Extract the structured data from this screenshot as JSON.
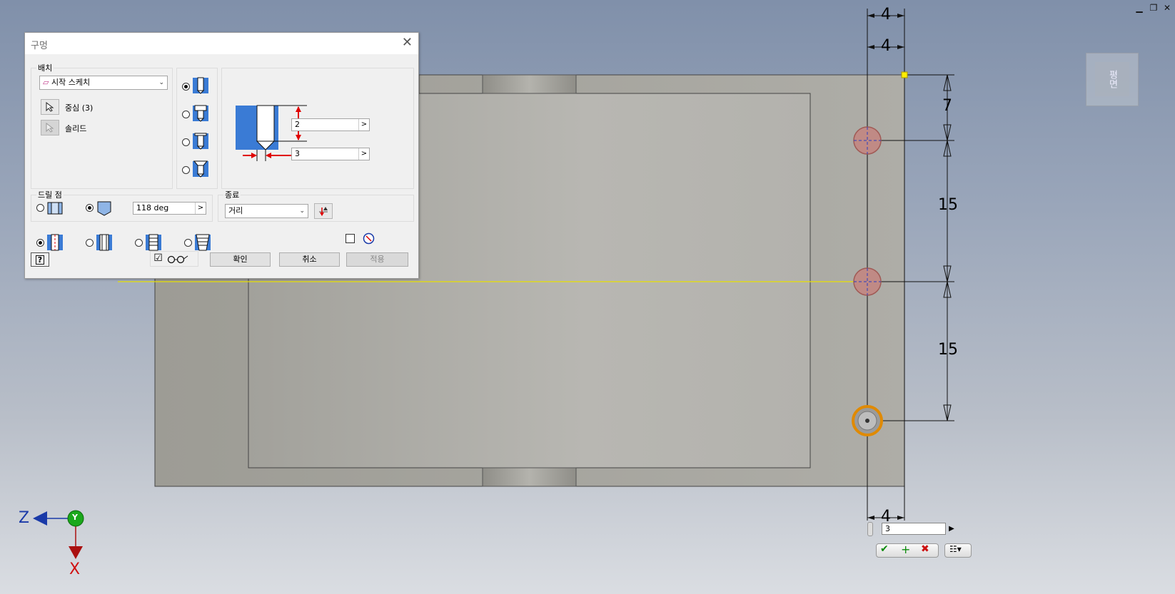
{
  "window": {
    "controls": [
      "▁",
      "❐",
      "✕"
    ]
  },
  "viewcube": {
    "face_label": "평면"
  },
  "dimensions": {
    "top_1": "4",
    "top_2": "4",
    "bottom": "4",
    "right_1": "7",
    "right_2": "15",
    "right_3": "15"
  },
  "triad": {
    "z": "Z",
    "y": "Y",
    "x": "X"
  },
  "dialog": {
    "title": "구멍",
    "close": "✕",
    "placement": {
      "label": "배치",
      "combo_value": "시작 스케치",
      "centers_label": "중심 (3)",
      "solid_label": "솔리드"
    },
    "preview": {
      "value_1": "2",
      "value_2": "3"
    },
    "drill_point": {
      "label": "드릴 점",
      "angle": "118 deg"
    },
    "termination": {
      "label": "종료",
      "combo_value": "거리"
    },
    "buttons": {
      "ok": "확인",
      "cancel": "취소",
      "apply": "적용"
    },
    "preview_checkbox": "☑"
  },
  "minibar": {
    "input_value": "3"
  },
  "colors": {
    "accent_red": "#e00000",
    "hatch_blue": "#3a7bd5",
    "part_gray": "#a8a79f"
  }
}
